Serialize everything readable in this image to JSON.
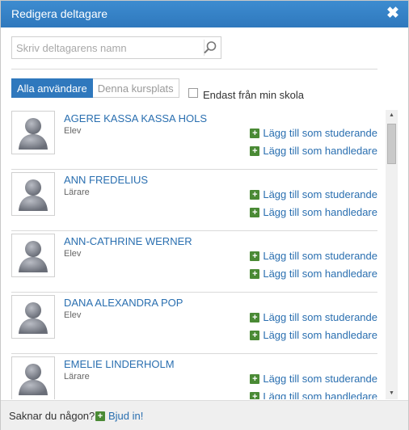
{
  "dialog": {
    "title": "Redigera deltagare"
  },
  "search": {
    "placeholder": "Skriv deltagarens namn"
  },
  "tabs": [
    {
      "label": "Alla användare",
      "active": true
    },
    {
      "label": "Denna kursplats",
      "active": false
    }
  ],
  "filter": {
    "label": "Endast från min skola",
    "checked": false
  },
  "actions": {
    "add_student": "Lägg till som studerande",
    "add_supervisor": "Lägg till som handledare"
  },
  "participants": [
    {
      "name": "AGERE KASSA KASSA HOLS",
      "role": "Elev"
    },
    {
      "name": "ANN FREDELIUS",
      "role": "Lärare"
    },
    {
      "name": "ANN-CATHRINE WERNER",
      "role": "Elev"
    },
    {
      "name": "DANA ALEXANDRA POP",
      "role": "Elev"
    },
    {
      "name": "EMELIE LINDERHOLM",
      "role": "Lärare"
    }
  ],
  "footer": {
    "question": "Saknar du någon?",
    "invite_label": "Bjud in!"
  },
  "colors": {
    "header": "#2f78bd",
    "link": "#2a6fb0",
    "add_icon": "#4a8a35"
  },
  "icons": {
    "close": "close-icon",
    "search": "search-icon",
    "add": "plus-icon",
    "avatar": "user-silhouette-icon"
  }
}
